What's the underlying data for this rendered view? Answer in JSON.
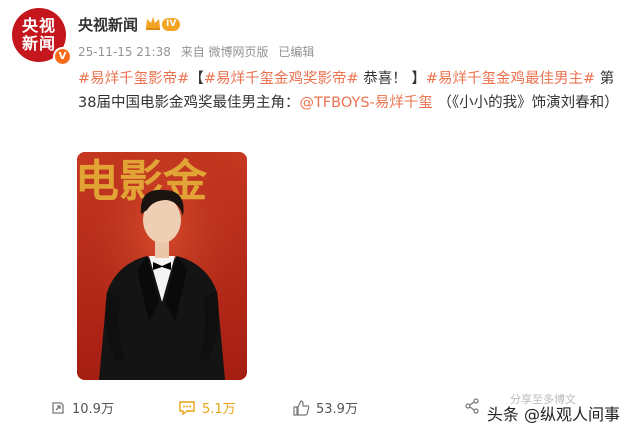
{
  "account": {
    "avatar_line1": "央视",
    "avatar_line2": "新闻",
    "verified_mark": "V",
    "name": "央视新闻",
    "level": "IV"
  },
  "meta": {
    "time": "25-11-15 21:38",
    "source": "来自 微博网页版",
    "edited": "已编辑"
  },
  "post": {
    "tag1": "#易烊千玺影帝#",
    "bracket_open": "【",
    "tag2": "#易烊千玺金鸡奖影帝#",
    "congrats": " 恭喜！ 】",
    "tag3": "#易烊千玺金鸡最佳男主#",
    "body": " 第38届中国电影金鸡奖最佳男主角：",
    "mention": "@TFBOYS-易烊千玺",
    "role": " （《小小的我》饰演刘春和）"
  },
  "photo": {
    "background_text": "电影金"
  },
  "actions": {
    "share_count": "10.9万",
    "comment_count": "5.1万",
    "like_count": "53.9万"
  },
  "watermark": {
    "small": "分享至多博文",
    "text": "头条 @纵观人间事"
  },
  "colors": {
    "accent": "#eb7350",
    "brand_red": "#c4161c",
    "badge_orange": "#f96b1a",
    "level_gold": "#f3a423",
    "photo_bg": "#c42a1a"
  },
  "icons": [
    "repost-icon",
    "comment-icon",
    "like-icon",
    "share-icon",
    "crown-icon"
  ]
}
